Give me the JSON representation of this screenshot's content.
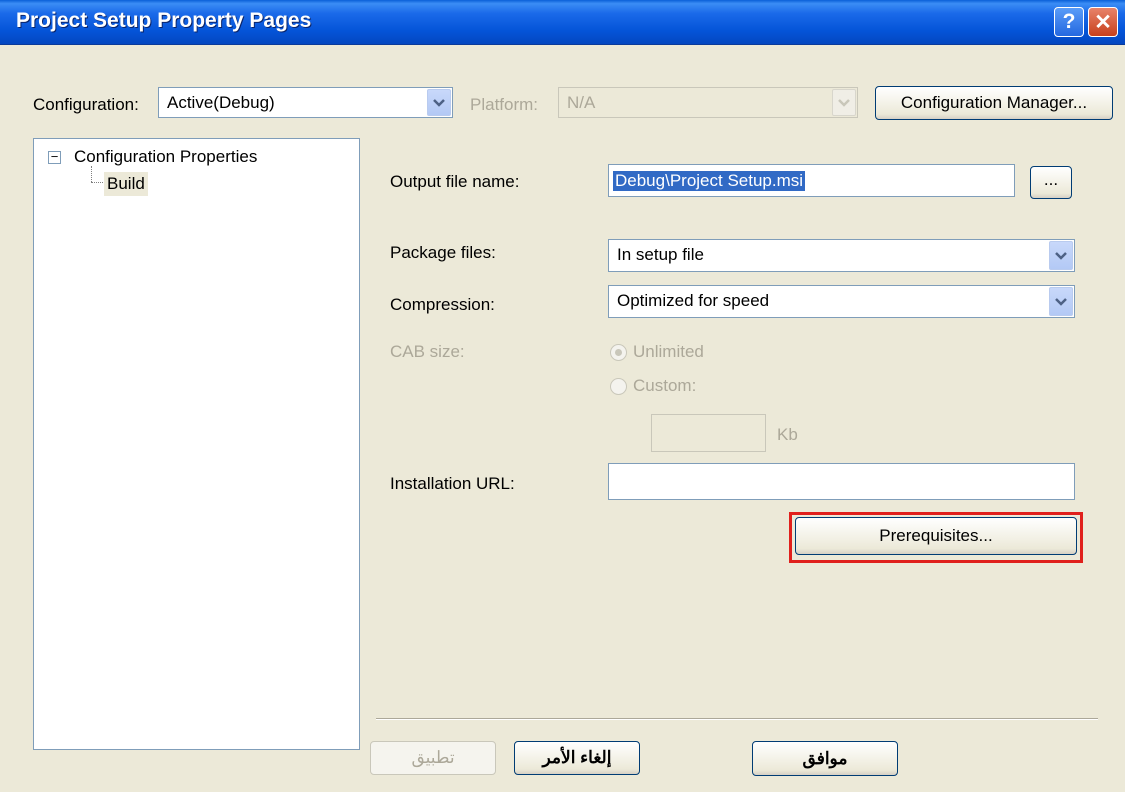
{
  "window": {
    "title": "Project Setup Property Pages",
    "help_label": "?",
    "close_label": "✕"
  },
  "config_bar": {
    "configuration_label": "Configuration:",
    "configuration_value": "Active(Debug)",
    "platform_label": "Platform:",
    "platform_value": "N/A",
    "config_manager_label": "Configuration Manager..."
  },
  "tree": {
    "expander": "−",
    "root_label": "Configuration Properties",
    "child_label": "Build"
  },
  "form": {
    "output_file_label": "Output file name:",
    "output_file_value": "Debug\\Project Setup.msi",
    "browse_label": "...",
    "package_files_label": "Package files:",
    "package_files_value": "In setup file",
    "compression_label": "Compression:",
    "compression_value": "Optimized for speed",
    "cab_size_label": "CAB size:",
    "unlimited_label": "Unlimited",
    "custom_label": "Custom:",
    "kb_label": "Kb",
    "installation_url_label": "Installation URL:",
    "installation_url_value": "",
    "prerequisites_label": "Prerequisites..."
  },
  "footer": {
    "ok_label": "موافق",
    "cancel_label": "إلغاء الأمر",
    "apply_label": "تطبيق"
  },
  "colors": {
    "highlight_box": "#e0201c",
    "selection": "#316ac5"
  }
}
